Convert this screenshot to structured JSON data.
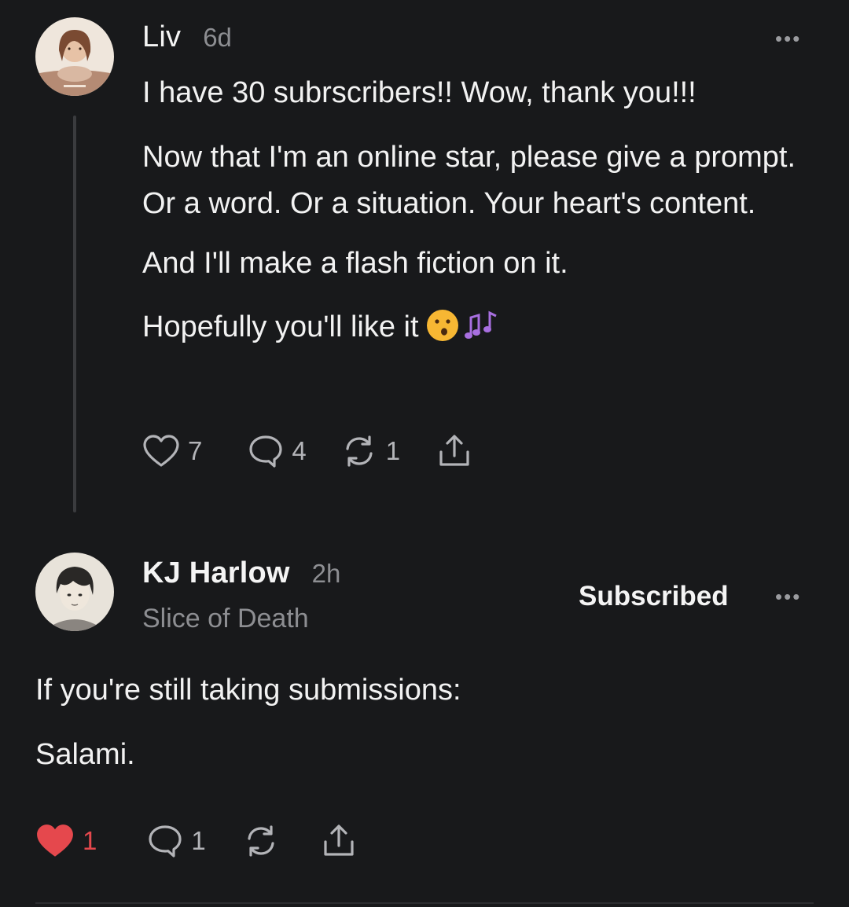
{
  "post": {
    "author": "Liv",
    "time": "6d",
    "more_label": "•••",
    "paragraphs": [
      "I have 30 subrscribers!! Wow, thank you!!!",
      "Now that I'm an online star, please give a prompt. Or a word. Or a situation. Your heart's content.",
      "And I'll make a flash fiction on it.",
      "Hopefully you'll like it"
    ],
    "emojis": [
      "kissing-face",
      "musical-notes"
    ],
    "likes": "7",
    "comments": "4",
    "restacks": "1"
  },
  "reply": {
    "author": "KJ Harlow",
    "time": "2h",
    "publication": "Slice of Death",
    "subscribed_label": "Subscribed",
    "more_label": "•••",
    "paragraphs": [
      "If you're still taking submissions:",
      "Salami."
    ],
    "likes": "1",
    "liked": true,
    "comments": "1"
  },
  "colors": {
    "background": "#18191b",
    "liked": "#e5484d",
    "muted": "#8d8e92"
  },
  "icons": [
    "heart-icon",
    "comment-icon",
    "restack-icon",
    "share-icon",
    "more-icon"
  ]
}
